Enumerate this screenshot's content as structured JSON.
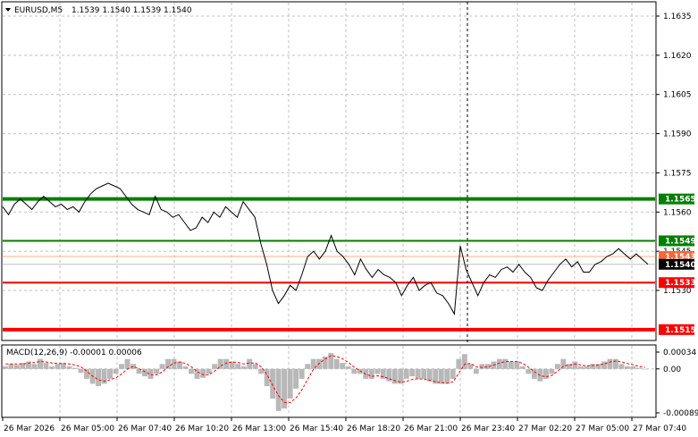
{
  "header": {
    "symbol": "EURUSD,M5",
    "ohlc": "1.1539 1.1540 1.1539 1.1540"
  },
  "macd": {
    "label": "MACD(12,26,9) -0.00001 0.00006",
    "axis_labels": [
      "0.00034",
      "0.00",
      "-0.00089"
    ]
  },
  "price_axis": {
    "ticks": [
      "1.1635",
      "1.1620",
      "1.1605",
      "1.1590",
      "1.1575",
      "1.1560",
      "1.1545",
      "1.1530"
    ]
  },
  "time_axis": {
    "labels": [
      "26 Mar 2026",
      "26 Mar 05:00",
      "26 Mar 07:40",
      "26 Mar 10:20",
      "26 Mar 13:00",
      "26 Mar 15:40",
      "26 Mar 18:20",
      "26 Mar 21:00",
      "26 Mar 23:40",
      "27 Mar 02:20",
      "27 Mar 05:00",
      "27 Mar 07:40"
    ]
  },
  "levels": [
    {
      "label": "1.1565",
      "price": 1.1565,
      "color": "#008000",
      "type": "thick"
    },
    {
      "label": "1.1549",
      "price": 1.1549,
      "color": "#008000",
      "type": "thin"
    },
    {
      "label": "1.1543",
      "price": 1.1543,
      "color": "#ff6633",
      "type": "marker"
    },
    {
      "label": "1.1540",
      "price": 1.154,
      "color": "#000000",
      "type": "current"
    },
    {
      "label": "1.1533",
      "price": 1.1533,
      "color": "#ff0000",
      "type": "thin"
    },
    {
      "label": "1.1515",
      "price": 1.1515,
      "color": "#ff0000",
      "type": "thick"
    }
  ],
  "chart_data": {
    "type": "line",
    "price_range": [
      1.1508,
      1.1642
    ],
    "macd_range": [
      -0.00089,
      0.00034
    ],
    "series": [
      {
        "name": "EURUSD,M5",
        "values": [
          1.1562,
          1.1559,
          1.1563,
          1.1565,
          1.1563,
          1.1561,
          1.1564,
          1.1566,
          1.1564,
          1.1562,
          1.1563,
          1.1561,
          1.1562,
          1.156,
          1.1564,
          1.1567,
          1.1569,
          1.157,
          1.1571,
          1.157,
          1.1569,
          1.1566,
          1.1563,
          1.1561,
          1.156,
          1.1559,
          1.1566,
          1.1561,
          1.156,
          1.1558,
          1.1559,
          1.1556,
          1.1553,
          1.1554,
          1.1558,
          1.1556,
          1.156,
          1.1558,
          1.1562,
          1.156,
          1.1558,
          1.1564,
          1.1561,
          1.1558,
          1.1548,
          1.154,
          1.153,
          1.1525,
          1.1528,
          1.1532,
          1.153,
          1.1536,
          1.1543,
          1.1545,
          1.1542,
          1.1545,
          1.1551,
          1.1545,
          1.1543,
          1.154,
          1.1536,
          1.1542,
          1.1538,
          1.1535,
          1.1538,
          1.1536,
          1.1535,
          1.1533,
          1.1528,
          1.1532,
          1.1535,
          1.153,
          1.1532,
          1.1533,
          1.1529,
          1.1528,
          1.1525,
          1.1521,
          1.1547,
          1.1538,
          1.1533,
          1.1528,
          1.1533,
          1.1536,
          1.1535,
          1.1538,
          1.1539,
          1.1537,
          1.154,
          1.1537,
          1.1535,
          1.1531,
          1.153,
          1.1534,
          1.1537,
          1.154,
          1.1542,
          1.1539,
          1.1541,
          1.1537,
          1.1537,
          1.154,
          1.1541,
          1.1543,
          1.1544,
          1.1546,
          1.1544,
          1.1542,
          1.1544,
          1.1542,
          1.154
        ]
      }
    ],
    "macd_histogram": [
      5e-05,
      0.0001,
      8e-05,
      0.00012,
      0.00015,
      0.0001,
      0.0002,
      0.00012,
      5e-05,
      0.0001,
      0.00012,
      5e-05,
      2e-05,
      -8e-05,
      -0.0002,
      -0.0003,
      -0.00035,
      -0.0003,
      -0.0002,
      -0.0001,
      0.0001,
      0.0002,
      0.0001,
      -0.0001,
      -0.00015,
      -0.0002,
      -0.0001,
      0.0001,
      0.0002,
      0.0002,
      0.00015,
      5e-05,
      -0.0001,
      -0.0002,
      -0.00018,
      -0.0001,
      0.0001,
      0.0002,
      0.0002,
      0.00015,
      0.0001,
      5e-05,
      0.0002,
      0.0001,
      -0.0001,
      -0.00035,
      -0.0006,
      -0.00085,
      -0.0008,
      -0.0006,
      -0.0004,
      -0.0002,
      0.0001,
      0.0002,
      0.0002,
      0.00025,
      0.00032,
      0.0002,
      0.00012,
      5e-05,
      -0.0001,
      -0.0001,
      -0.0002,
      -0.0002,
      -0.0001,
      -0.0002,
      -0.00025,
      -0.0003,
      -0.0003,
      -0.0002,
      -0.00015,
      -0.0002,
      -0.0002,
      -0.00025,
      -0.0003,
      -0.0003,
      -0.0003,
      -0.0002,
      0.0002,
      0.0003,
      0.0001,
      -0.0001,
      0.0001,
      0.0001,
      0.00015,
      0.0002,
      0.0002,
      0.00015,
      0.00015,
      5e-05,
      -0.0001,
      -0.0002,
      -0.00025,
      -0.0002,
      -0.0001,
      0.0001,
      0.0002,
      0.0001,
      0.00015,
      5e-05,
      5e-05,
      0.0001,
      0.0001,
      0.00015,
      0.0002,
      0.0002,
      0.0001,
      5e-05,
      5e-05,
      2e-05,
      0.0
    ],
    "macd_signal": [
      0.0001,
      0.0001,
      0.0001,
      0.0001,
      0.00012,
      0.00013,
      0.00015,
      0.00014,
      0.00012,
      0.00011,
      0.00011,
      0.0001,
      8e-05,
      4e-05,
      -5e-05,
      -0.00015,
      -0.00022,
      -0.00025,
      -0.00022,
      -0.00018,
      -0.0001,
      0.0,
      5e-05,
      0.0,
      -6e-05,
      -0.00012,
      -0.00012,
      -6e-05,
      5e-05,
      0.00012,
      0.00014,
      0.00011,
      4e-05,
      -6e-05,
      -0.00012,
      -0.00012,
      -4e-05,
      6e-05,
      0.00012,
      0.00014,
      0.00013,
      0.0001,
      0.00012,
      0.00012,
      4e-05,
      -0.00012,
      -0.00035,
      -0.00055,
      -0.00068,
      -0.00068,
      -0.00058,
      -0.00042,
      -0.0002,
      0.0,
      0.00012,
      0.0002,
      0.00027,
      0.00025,
      0.0002,
      0.00013,
      3e-05,
      -4e-05,
      -0.00011,
      -0.00015,
      -0.00014,
      -0.00016,
      -0.0002,
      -0.00024,
      -0.00027,
      -0.00025,
      -0.00021,
      -0.0002,
      -0.00021,
      -0.00023,
      -0.00026,
      -0.00028,
      -0.00029,
      -0.00026,
      -8e-05,
      0.0001,
      0.00011,
      4e-05,
      3e-05,
      4e-05,
      8e-05,
      0.00012,
      0.00015,
      0.00015,
      0.00015,
      0.00011,
      3e-05,
      -6e-05,
      -0.00014,
      -0.00016,
      -0.00013,
      -4e-05,
      6e-05,
      8e-05,
      0.0001,
      8e-05,
      6e-05,
      7e-05,
      8e-05,
      0.0001,
      0.00014,
      0.00016,
      0.00014,
      0.00011,
      8e-05,
      5e-05,
      3e-05
    ]
  }
}
